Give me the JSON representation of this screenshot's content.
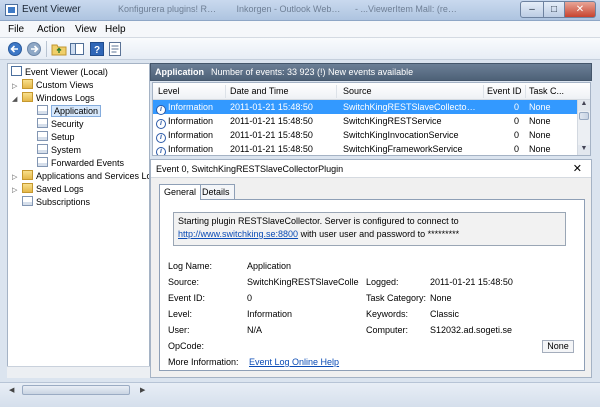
{
  "window": {
    "title": "Event Viewer",
    "background_tabs": [
      "Konfigurera plugins! REST Versio...",
      "Inkorgen - Outlook Web Access Light...",
      "- ...ViewerItem Mall: (reference)..."
    ],
    "controls": {
      "minimize": "–",
      "maximize": "□",
      "close": "✕"
    }
  },
  "menu": {
    "file": "File",
    "action": "Action",
    "view": "View",
    "help": "Help"
  },
  "toolbar": {
    "icons": [
      "back-arrow-icon",
      "forward-arrow-icon",
      "up-folder-icon",
      "console-tree-icon",
      "help-icon",
      "properties-icon"
    ]
  },
  "tree": {
    "root": "Event Viewer (Local)",
    "custom_views": "Custom Views",
    "windows_logs": "Windows Logs",
    "application": "Application",
    "security": "Security",
    "setup": "Setup",
    "system": "System",
    "forwarded": "Forwarded Events",
    "apps_services": "Applications and Services Logs",
    "saved_logs": "Saved Logs",
    "subscriptions": "Subscriptions"
  },
  "list_header": {
    "title": "Application",
    "info": "Number of events: 33 923 (!) New events available"
  },
  "columns": {
    "level": "Level",
    "datetime": "Date and Time",
    "source": "Source",
    "event_id": "Event ID",
    "task_category": "Task C..."
  },
  "events": [
    {
      "level": "Information",
      "datetime": "2011-01-21 15:48:50",
      "source": "SwitchKingRESTSlaveCollectorPlugin",
      "event_id": "0",
      "task": "None"
    },
    {
      "level": "Information",
      "datetime": "2011-01-21 15:48:50",
      "source": "SwitchKingRESTService",
      "event_id": "0",
      "task": "None"
    },
    {
      "level": "Information",
      "datetime": "2011-01-21 15:48:50",
      "source": "SwitchKingInvocationService",
      "event_id": "0",
      "task": "None"
    },
    {
      "level": "Information",
      "datetime": "2011-01-21 15:48:50",
      "source": "SwitchKingFrameworkService",
      "event_id": "0",
      "task": "None"
    }
  ],
  "detail": {
    "title": "Event 0, SwitchKingRESTSlaveCollectorPlugin",
    "close": "✕",
    "tabs": {
      "general": "General",
      "details": "Details"
    },
    "message_line1": "Starting plugin RESTSlaveCollector. Server is configured to connect to",
    "message_link": "http://www.switchking.se:8800",
    "message_line2": " with user user and password to *********",
    "labels": {
      "log_name": "Log Name:",
      "source": "Source:",
      "event_id": "Event ID:",
      "level": "Level:",
      "user": "User:",
      "opcode": "OpCode:",
      "more_info": "More Information:",
      "logged": "Logged:",
      "task_category": "Task Category:",
      "keywords": "Keywords:",
      "computer": "Computer:"
    },
    "values": {
      "log_name": "Application",
      "source": "SwitchKingRESTSlaveCollect",
      "event_id": "0",
      "level": "Information",
      "user": "N/A",
      "opcode": "",
      "more_info": "Event Log Online Help",
      "logged": "2011-01-21 15:48:50",
      "task_category": "None",
      "keywords": "Classic",
      "computer": "S12032.ad.sogeti.se"
    },
    "tooltip": "None"
  }
}
